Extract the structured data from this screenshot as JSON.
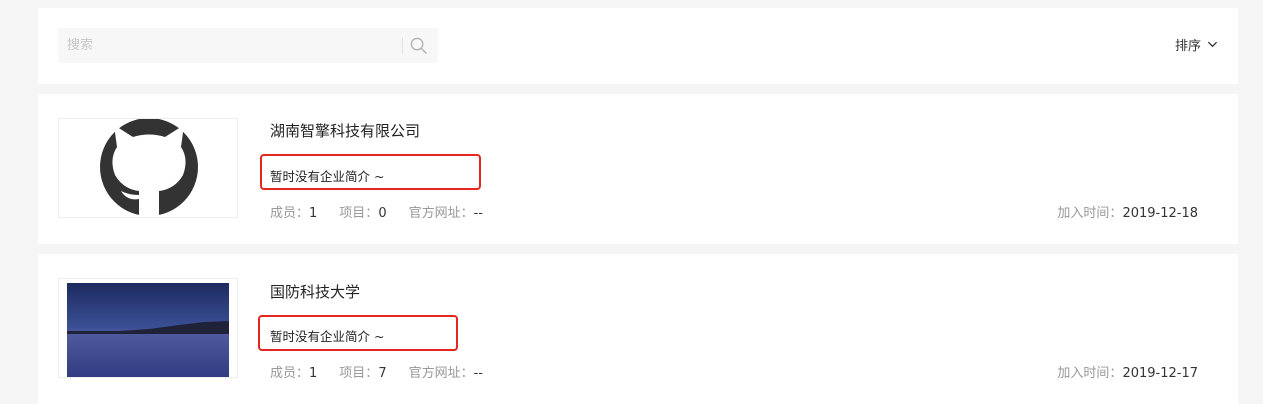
{
  "search": {
    "placeholder": "搜索"
  },
  "sort": {
    "label": "排序"
  },
  "labels": {
    "members": "成员：",
    "projects": "项目：",
    "website": "官方网址：",
    "joined": "加入时间："
  },
  "orgs": [
    {
      "name": "湖南智擎科技有限公司",
      "intro": "暂时没有企业简介 ~",
      "members": "1",
      "projects": "0",
      "website": "--",
      "joined": "2019-12-18",
      "logo": "github-octocat-icon"
    },
    {
      "name": "国防科技大学",
      "intro": "暂时没有企业简介 ~",
      "members": "1",
      "projects": "7",
      "website": "--",
      "joined": "2019-12-17",
      "logo": "snowfield-twilight-photo"
    }
  ],
  "colors": {
    "highlight": "#e5261f",
    "background": "#f5f5f5"
  }
}
